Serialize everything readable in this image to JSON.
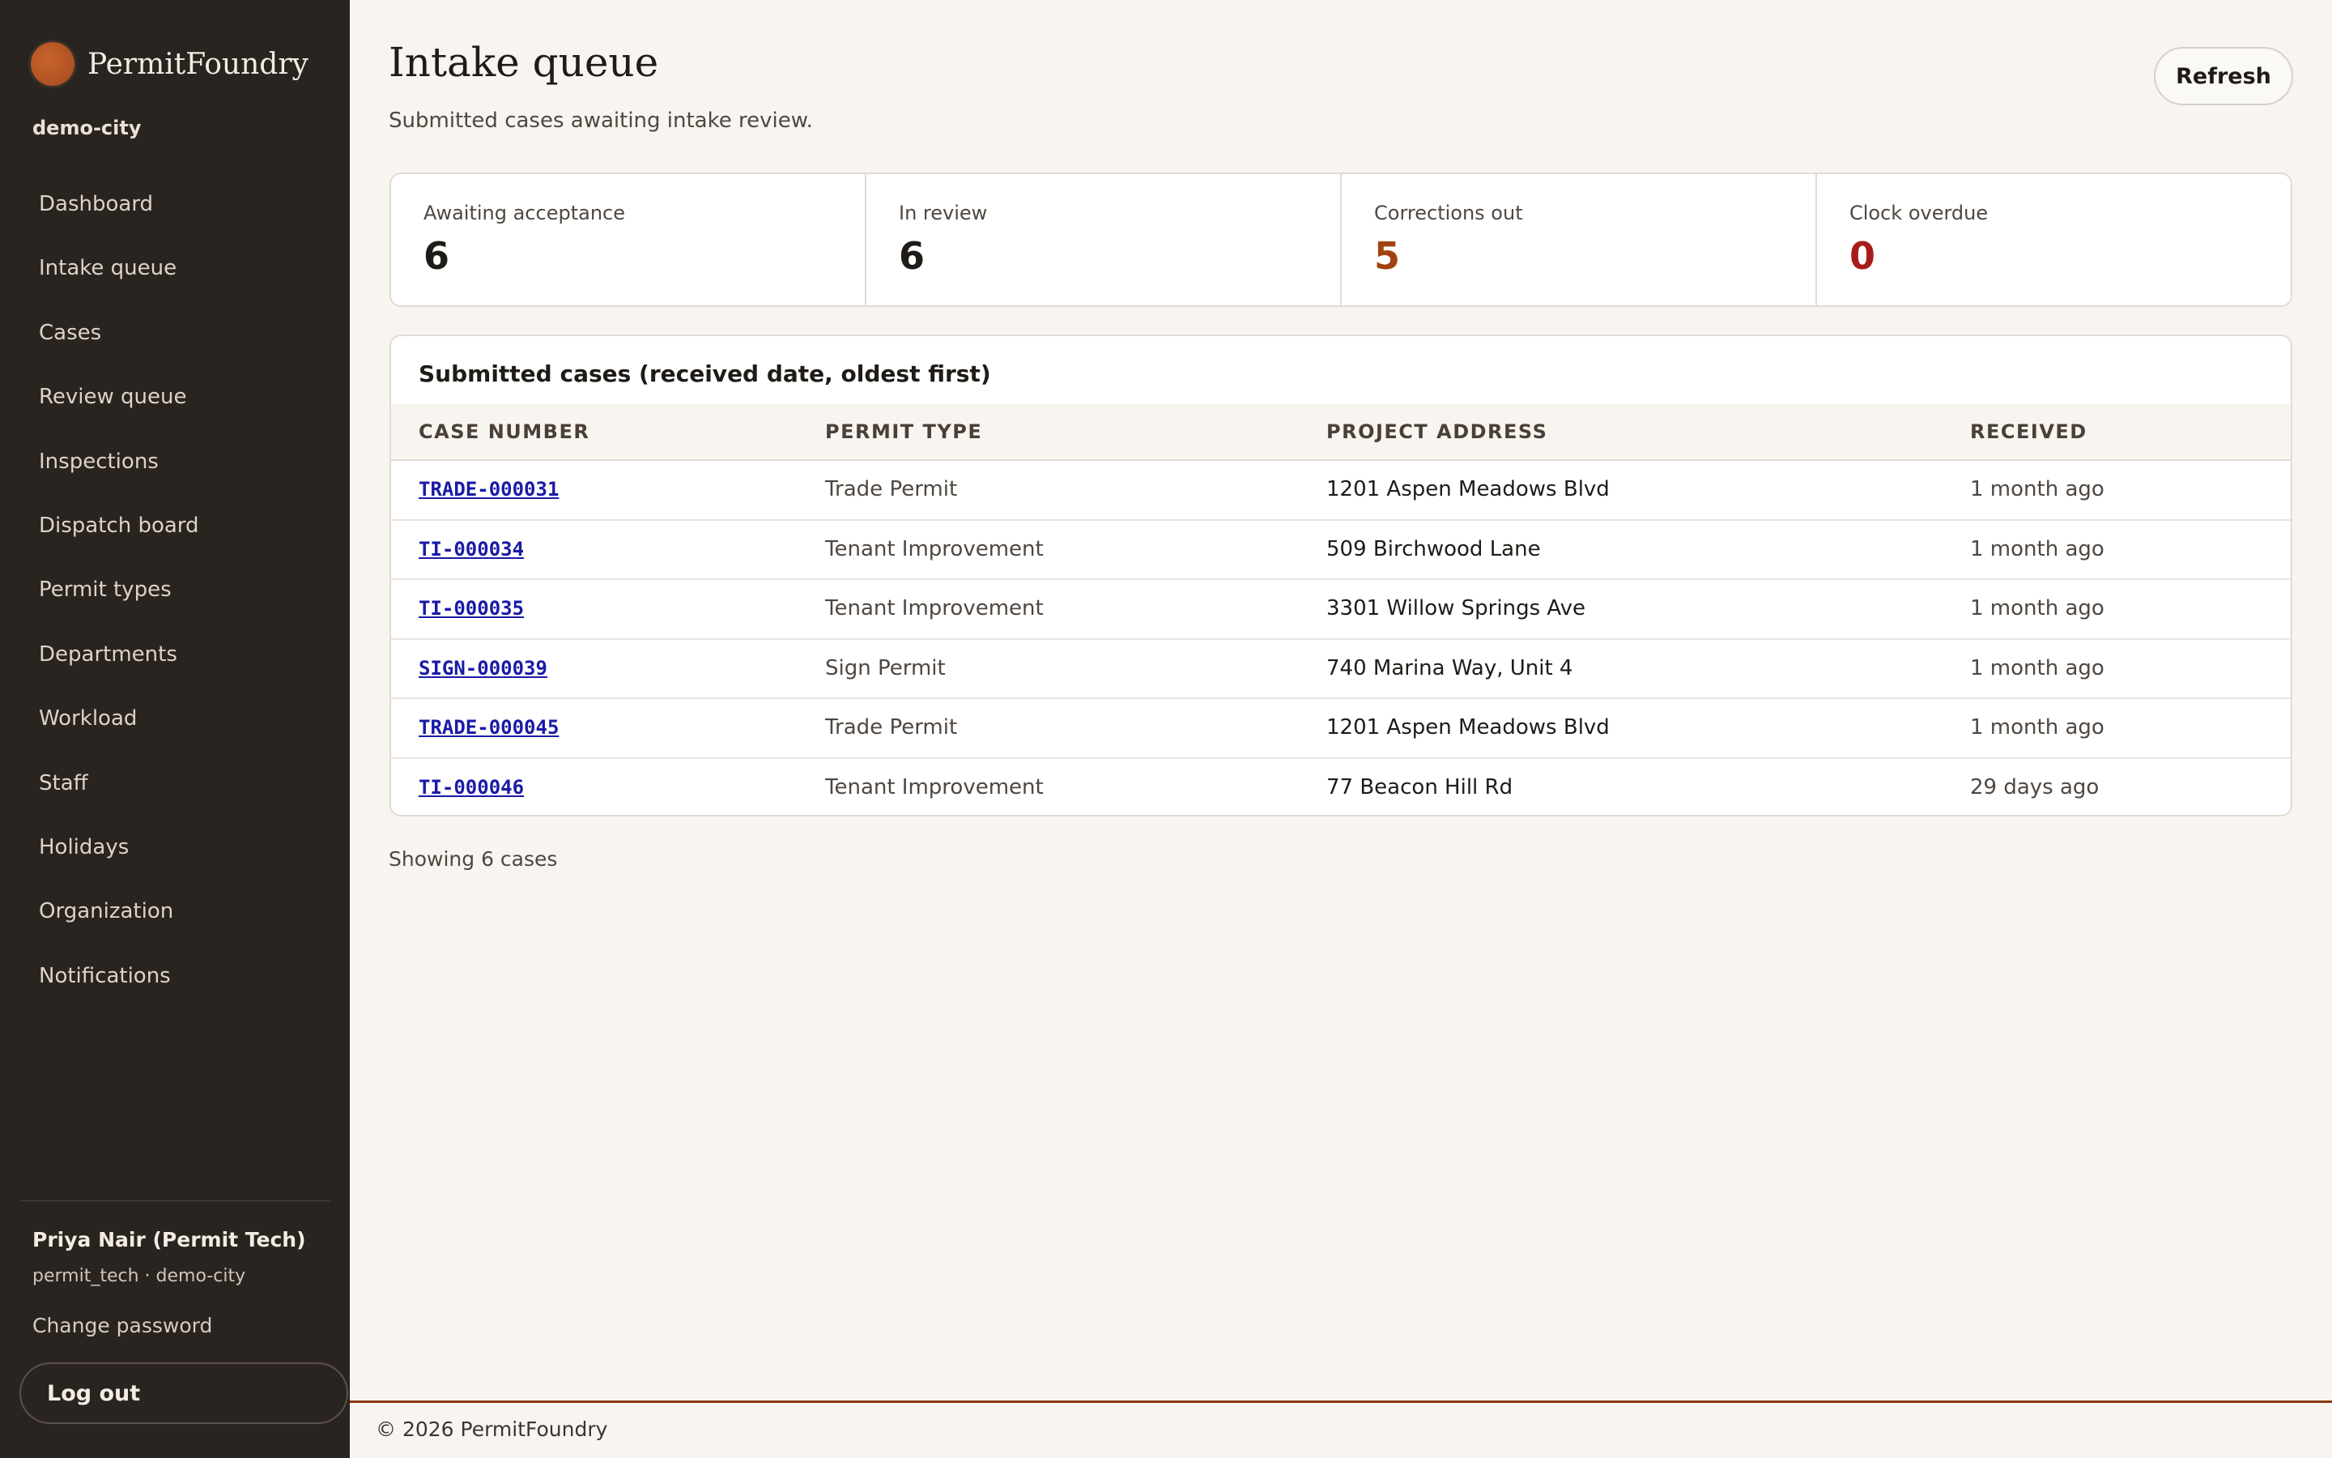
{
  "brand": {
    "name": "PermitFoundry",
    "tenant": "demo-city"
  },
  "nav": [
    "Dashboard",
    "Intake queue",
    "Cases",
    "Review queue",
    "Inspections",
    "Dispatch board",
    "Permit types",
    "Departments",
    "Workload",
    "Staff",
    "Holidays",
    "Organization",
    "Notifications"
  ],
  "user": {
    "name": "Priya Nair (Permit Tech)",
    "meta": "permit_tech · demo-city",
    "change_password": "Change password",
    "logout": "Log out"
  },
  "page": {
    "title": "Intake queue",
    "subtitle": "Submitted cases awaiting intake review.",
    "refresh": "Refresh"
  },
  "stats": [
    {
      "label": "Awaiting acceptance",
      "value": "6",
      "color": "#1f1b17"
    },
    {
      "label": "In review",
      "value": "6",
      "color": "#1f1b17"
    },
    {
      "label": "Corrections out",
      "value": "5",
      "color": "#a3420f"
    },
    {
      "label": "Clock overdue",
      "value": "0",
      "color": "#a81c1c"
    }
  ],
  "table": {
    "title": "Submitted cases (received date, oldest first)",
    "columns": [
      "CASE NUMBER",
      "PERMIT TYPE",
      "PROJECT ADDRESS",
      "RECEIVED"
    ],
    "rows": [
      {
        "case": "TRADE-000031",
        "type": "Trade Permit",
        "address": "1201 Aspen Meadows Blvd",
        "received": "1 month ago"
      },
      {
        "case": "TI-000034",
        "type": "Tenant Improvement",
        "address": "509 Birchwood Lane",
        "received": "1 month ago"
      },
      {
        "case": "TI-000035",
        "type": "Tenant Improvement",
        "address": "3301 Willow Springs Ave",
        "received": "1 month ago"
      },
      {
        "case": "SIGN-000039",
        "type": "Sign Permit",
        "address": "740 Marina Way, Unit 4",
        "received": "1 month ago"
      },
      {
        "case": "TRADE-000045",
        "type": "Trade Permit",
        "address": "1201 Aspen Meadows Blvd",
        "received": "1 month ago"
      },
      {
        "case": "TI-000046",
        "type": "Tenant Improvement",
        "address": "77 Beacon Hill Rd",
        "received": "29 days ago"
      }
    ],
    "showing": "Showing 6 cases"
  },
  "footer": {
    "text": "© 2026 PermitFoundry"
  }
}
